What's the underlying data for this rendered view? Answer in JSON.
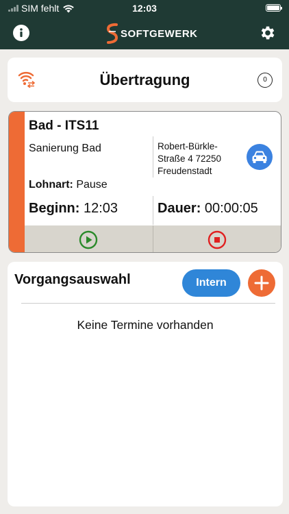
{
  "status_bar": {
    "carrier": "SIM fehlt",
    "time": "12:03"
  },
  "nav": {
    "logo_text": "SOFTGEWERK",
    "icons": {
      "info": "info-icon",
      "settings": "gear-icon"
    }
  },
  "transfer": {
    "title": "Übertragung",
    "count": "0",
    "icon": "wifi-transfer-icon"
  },
  "job": {
    "title": "Bad - ITS11",
    "description": "Sanierung Bad",
    "address": "Robert-Bürkle-Straße 4 72250 Freudenstadt",
    "lohnart_label": "Lohnart:",
    "lohnart_value": "Pause",
    "beginn_label": "Beginn:",
    "beginn_value": "12:03",
    "dauer_label": "Dauer:",
    "dauer_value": "00:00:05",
    "colors": {
      "accent": "#ee6b35",
      "car": "#3b82e0",
      "play": "#2a8a2a",
      "stop": "#e02020"
    }
  },
  "selection": {
    "title": "Vorgangsauswahl",
    "intern_label": "Intern",
    "empty_text": "Keine Termine vorhanden",
    "colors": {
      "intern": "#2f86d8",
      "add": "#ee6b35"
    }
  }
}
